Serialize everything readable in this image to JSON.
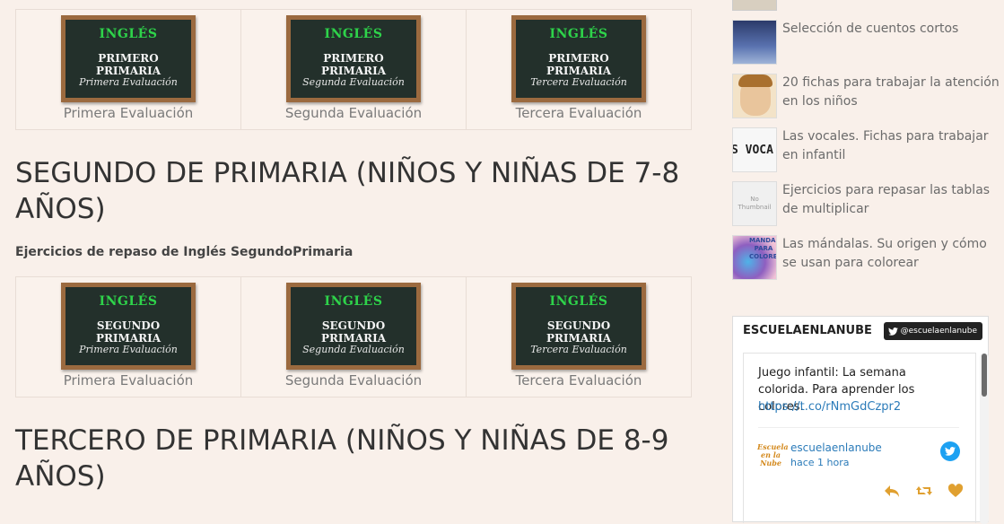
{
  "sections": [
    {
      "boards": [
        {
          "line1": "INGLÉS",
          "line2": "PRIMERO PRIMARIA",
          "line3": "Primera Evaluación",
          "caption": "Primera Evaluación"
        },
        {
          "line1": "INGLÉS",
          "line2": "PRIMERO PRIMARIA",
          "line3": "Segunda Evaluación",
          "caption": "Segunda Evaluación"
        },
        {
          "line1": "INGLÉS",
          "line2": "PRIMERO PRIMARIA",
          "line3": "Tercera Evaluación",
          "caption": "Tercera Evaluación"
        }
      ]
    },
    {
      "heading": "SEGUNDO DE PRIMARIA (NIÑOS Y NIÑAS DE 7-8 AÑOS)",
      "subheading": "Ejercicios de repaso de Inglés SegundoPrimaria",
      "boards": [
        {
          "line1": "INGLÉS",
          "line2": "SEGUNDO PRIMARIA",
          "line3": "Primera Evaluación",
          "caption": "Primera Evaluación"
        },
        {
          "line1": "INGLÉS",
          "line2": "SEGUNDO PRIMARIA",
          "line3": "Segunda Evaluación",
          "caption": "Segunda Evaluación"
        },
        {
          "line1": "INGLÉS",
          "line2": "SEGUNDO PRIMARIA",
          "line3": "Tercera Evaluación",
          "caption": "Tercera Evaluación"
        }
      ]
    },
    {
      "heading": "TERCERO DE PRIMARIA (NIÑOS Y NIÑAS DE 8-9 AÑOS)"
    }
  ],
  "sidebar": {
    "posts": [
      {
        "title": "Selección de cuentos cortos",
        "thumb": "night-sky-thumb"
      },
      {
        "title": "20 fichas para trabajar la atención en los niños",
        "thumb": "child-face-thumb"
      },
      {
        "title": "Las vocales. Fichas para trabajar en infantil",
        "thumb": "vocales-thumb"
      },
      {
        "title": "Ejercicios para repasar las tablas de multiplicar",
        "thumb": "no-thumbnail",
        "thumb_text": "No Thumbnail"
      },
      {
        "title": "Las mándalas. Su origen y cómo se usan para colorear",
        "thumb": "mandala-thumb",
        "thumb_text": "MANDALAS PARA COLOREAR"
      }
    ],
    "vocales_thumb_text": "S VOCA",
    "twitter": {
      "header": "ESCUELAENLANUBE",
      "follow": "@escuelaenlanube",
      "tweet_text": "Juego infantil: La semana colorida. Para aprender los colores.",
      "tweet_link": "https://t.co/rNmGdCzpr2",
      "user": "escuelaenlanube",
      "time": "hace 1 hora",
      "avatar_text": "Escuela en la Nube",
      "accent": "#1da1f2",
      "action_color": "#e0a030"
    }
  }
}
